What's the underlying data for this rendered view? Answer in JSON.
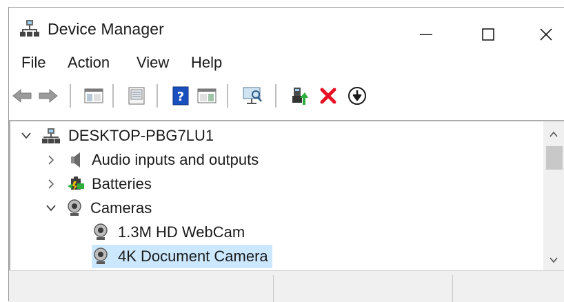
{
  "window": {
    "title": "Device Manager"
  },
  "menu": [
    "File",
    "Action",
    "View",
    "Help"
  ],
  "toolbar": {
    "buttons": [
      "back-arrow-icon",
      "forward-arrow-icon",
      "show-hide-console-tree-icon",
      "properties-icon",
      "help-icon",
      "show-hide-action-pane-icon",
      "scan-hardware-changes-icon",
      "update-driver-icon",
      "uninstall-device-icon",
      "enable-device-icon"
    ]
  },
  "tree": {
    "computer": "DESKTOP-PBG7LU1",
    "categories": [
      {
        "label": "Audio inputs and outputs",
        "expanded": false,
        "icon": "speaker-icon"
      },
      {
        "label": "Batteries",
        "expanded": false,
        "icon": "battery-icon"
      },
      {
        "label": "Cameras",
        "expanded": true,
        "icon": "webcam-icon"
      }
    ],
    "camera_devices": [
      {
        "label": "1.3M HD WebCam",
        "selected": false
      },
      {
        "label": "4K Document Camera",
        "selected": true
      }
    ]
  },
  "colors": {
    "selection": "#cce8ff",
    "delete_red": "#e81123",
    "help_blue": "#1a4fbf"
  }
}
